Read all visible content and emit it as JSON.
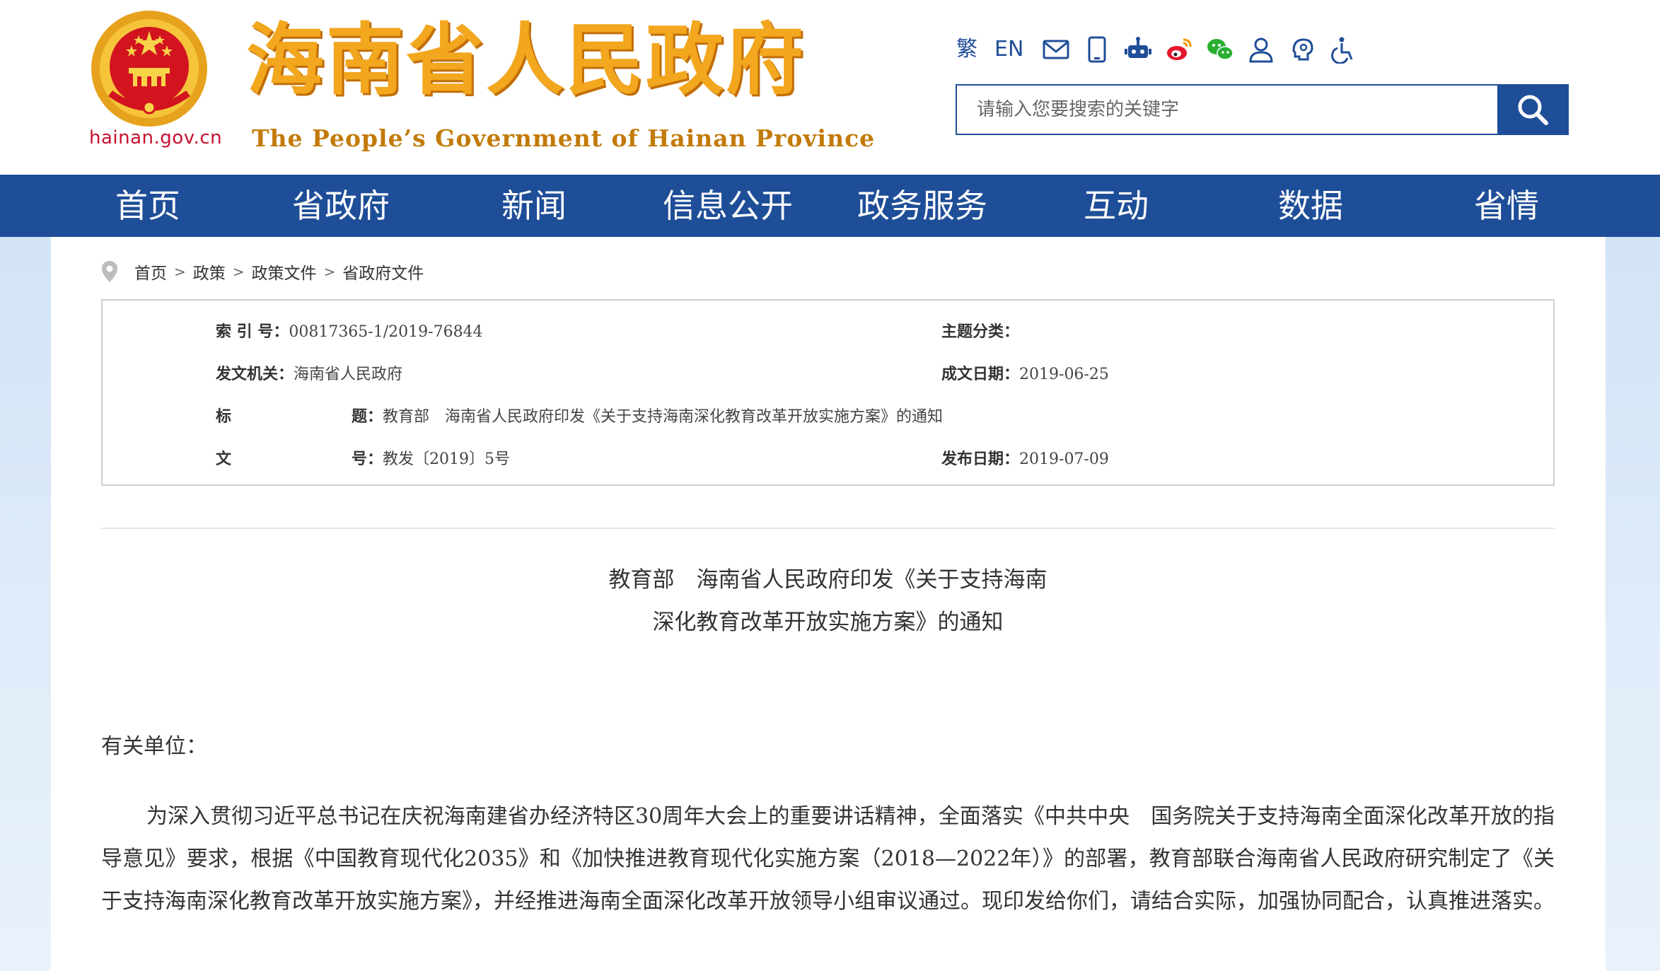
{
  "header": {
    "domain": "hainan.gov.cn",
    "title": "海南省人民政府",
    "subtitle": "The People’s Government  of Hainan Province",
    "tools": {
      "traditional": "繁",
      "english": "EN",
      "icons": [
        "mail-icon",
        "mobile-icon",
        "robot-icon",
        "weibo-icon",
        "wechat-icon",
        "user-icon",
        "elder-care-icon",
        "accessibility-icon"
      ]
    },
    "search": {
      "placeholder": "请输入您要搜索的关键字"
    }
  },
  "nav": {
    "items": [
      {
        "label": "首页"
      },
      {
        "label": "省政府"
      },
      {
        "label": "新闻"
      },
      {
        "label": "信息公开"
      },
      {
        "label": "政务服务"
      },
      {
        "label": "互动"
      },
      {
        "label": "数据"
      },
      {
        "label": "省情"
      }
    ]
  },
  "breadcrumb": {
    "items": [
      "首页",
      "政策",
      "政策文件",
      "省政府文件"
    ],
    "separator": ">"
  },
  "meta": {
    "index_label": "索 引 号：",
    "index_value": "00817365-1/2019-76844",
    "topic_label": "主题分类：",
    "topic_value": "",
    "issuer_label": "发文机关：",
    "issuer_value": "海南省人民政府",
    "created_label": "成文日期：",
    "created_value": "2019-06-25",
    "title_label_a": "标",
    "title_label_b": "题：",
    "title_value": "教育部　海南省人民政府印发《关于支持海南深化教育改革开放实施方案》的通知",
    "docno_label_a": "文",
    "docno_label_b": "号：",
    "docno_value": "教发〔2019〕5号",
    "published_label": "发布日期：",
    "published_value": "2019-07-09"
  },
  "document": {
    "title_line1": "教育部　海南省人民政府印发《关于支持海南",
    "title_line2": "深化教育改革开放实施方案》的通知",
    "salutation": "有关单位：",
    "paragraph": "为深入贯彻习近平总书记在庆祝海南建省办经济特区30周年大会上的重要讲话精神，全面落实《中共中央　国务院关于支持海南全面深化改革开放的指导意见》要求，根据《中国教育现代化2035》和《加快推进教育现代化实施方案（2018—2022年）》的部署，教育部联合海南省人民政府研究制定了《关于支持海南深化教育改革开放实施方案》，并经推进海南全面深化改革开放领导小组审议通过。现印发给你们，请结合实际，加强协同配合，认真推进落实。"
  },
  "colors": {
    "nav_blue": "#1f4e98",
    "title_gold": "#f2a71e",
    "emblem_red": "#c8102e"
  }
}
